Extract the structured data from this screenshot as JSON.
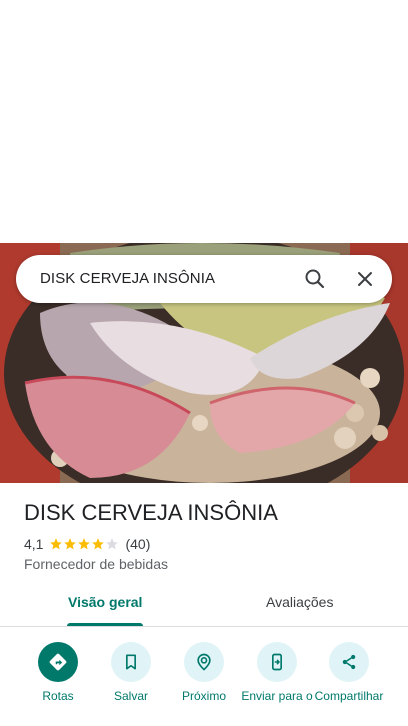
{
  "search": {
    "query": "DISK CERVEJA INSÔNIA"
  },
  "place": {
    "title": "DISK CERVEJA INSÔNIA",
    "rating": "4,1",
    "rating_stars": 4.1,
    "review_count": "(40)",
    "category": "Fornecedor de bebidas"
  },
  "tabs": [
    {
      "label": "Visão geral"
    },
    {
      "label": "Avaliações"
    }
  ],
  "actions": [
    {
      "label": "Rotas",
      "icon": "directions-icon"
    },
    {
      "label": "Salvar",
      "icon": "bookmark-icon"
    },
    {
      "label": "Próximo",
      "icon": "nearby-icon"
    },
    {
      "label": "Enviar para o",
      "icon": "send-to-phone-icon"
    },
    {
      "label": "Compartilhar",
      "icon": "share-icon"
    }
  ],
  "colors": {
    "accent": "#00796b",
    "action_bg": "#e0f4f7",
    "star": "#fbbc04"
  }
}
